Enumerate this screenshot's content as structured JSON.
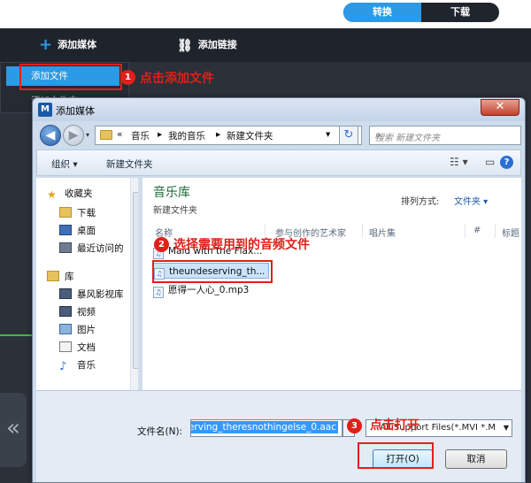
{
  "tabs": [
    {
      "label": "转换",
      "active": true
    },
    {
      "label": "下载",
      "active": false
    }
  ],
  "toolbar": {
    "add_media_label": "添加媒体",
    "add_link_label": "添加链接",
    "add_media_icon": "plus-icon",
    "add_link_icon": "link-icon"
  },
  "dropdown": {
    "items": [
      "添加文件",
      "添加文件夹"
    ]
  },
  "annotations": {
    "step1": {
      "num": "1",
      "text": "点击添加文件"
    },
    "step2": {
      "num": "2",
      "text": "选择需要用到的音频文件"
    },
    "step3": {
      "num": "3",
      "text": "点击打开"
    },
    "color": "#e0201a"
  },
  "dialog": {
    "title": "添加媒体",
    "logo": "M",
    "address": {
      "prefix": "«",
      "parts": [
        "音乐",
        "我的音乐",
        "新建文件夹"
      ],
      "separator": "▸"
    },
    "search_placeholder": "搜索 新建文件夹",
    "commands": {
      "organize": "组织 ▾",
      "new_folder": "新建文件夹"
    },
    "help": "?",
    "nav": {
      "favorites_label": "收藏夹",
      "favorites": [
        "下载",
        "桌面",
        "最近访问的"
      ],
      "library_label": "库",
      "libraries": [
        "暴风影视库",
        "视频",
        "图片",
        "文档",
        "音乐"
      ]
    },
    "library": {
      "title": "音乐库",
      "subtitle": "新建文件夹",
      "sort_label": "排列方式:",
      "sort_value": "文件夹 ▾"
    },
    "columns": [
      "名称",
      "参与创作的艺术家",
      "唱片集",
      "#",
      "标题"
    ],
    "files": [
      {
        "name": "Maid with the Flax...",
        "selected": false
      },
      {
        "name": "theundeserving_th...",
        "selected": true
      },
      {
        "name": "愿得一人心_0.mp3",
        "selected": false
      }
    ],
    "filename_label": "文件名(N):",
    "filename_value": "erving_theresnothingelse_0.aac",
    "filetype_value": "All Support Files(*.MVI *.M",
    "open_label": "打开(O)",
    "cancel_label": "取消"
  },
  "colors": {
    "accent": "#2c9ae6",
    "background": "#2b3039"
  }
}
